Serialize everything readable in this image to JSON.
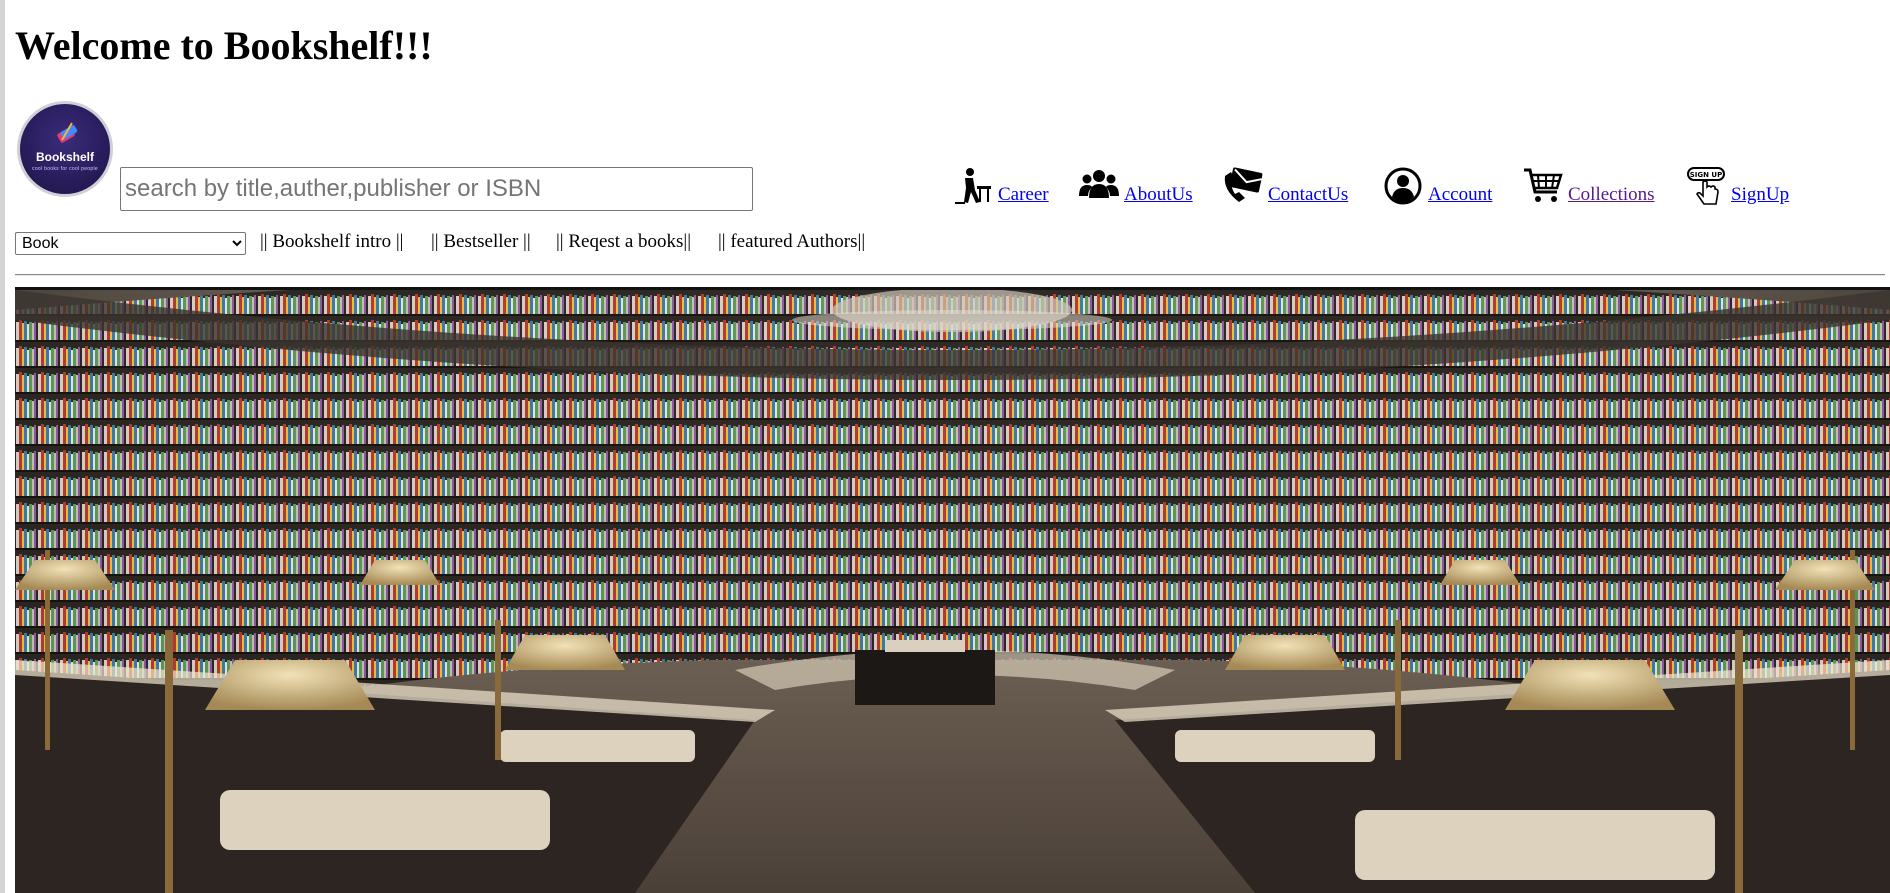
{
  "header": {
    "title": "Welcome to Bookshelf!!!"
  },
  "logo": {
    "name": "Bookshelf",
    "tagline": "cool books for cool people"
  },
  "search": {
    "placeholder": "search by title,auther,publisher or ISBN",
    "value": ""
  },
  "nav": {
    "items": [
      {
        "label": "Career",
        "icon": "career-icon"
      },
      {
        "label": "AboutUs",
        "icon": "people-icon"
      },
      {
        "label": "ContactUs",
        "icon": "phone-mail-icon"
      },
      {
        "label": "Account",
        "icon": "user-circle-icon"
      },
      {
        "label": "Collections",
        "icon": "cart-icon"
      },
      {
        "label": "SignUp",
        "icon": "signup-hand-icon"
      }
    ]
  },
  "category_select": {
    "selected": "Book"
  },
  "menu": {
    "intro": "|| Bookshelf intro ||",
    "bestseller": "|| Bestseller ||",
    "request": "|| Reqest a books||",
    "authors": "|| featured Authors||"
  },
  "hero": {
    "description_icon": "bookstore-interior-photo"
  },
  "colors": {
    "link": "#0000ee",
    "visited_link": "#551a8b",
    "logo_bg": "#2a1d5e"
  }
}
